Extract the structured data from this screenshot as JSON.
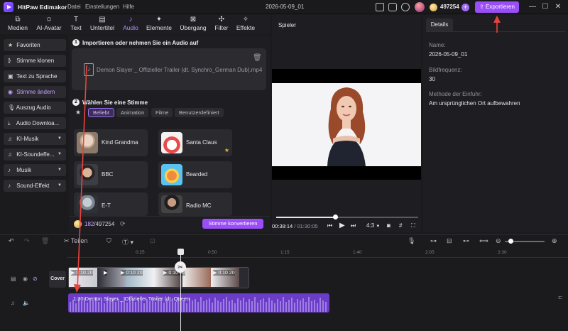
{
  "app": {
    "title": "HitPaw Edimakor",
    "menus": [
      "Datei",
      "Einstellungen",
      "Hilfe"
    ],
    "project_title": "2026-05-09_01",
    "credits": "497254",
    "plus": "+",
    "export_label": "Exportieren",
    "window_controls": [
      "—",
      "☐",
      "✕"
    ]
  },
  "toolbar": {
    "tabs": [
      {
        "label": "Medien",
        "icon": "media-icon"
      },
      {
        "label": "AI-Avatar",
        "icon": "ai-avatar-icon"
      },
      {
        "label": "Text",
        "icon": "text-icon"
      },
      {
        "label": "Untertitel",
        "icon": "subtitle-icon"
      },
      {
        "label": "Audio",
        "icon": "audio-icon"
      },
      {
        "label": "Elemente",
        "icon": "elements-icon"
      },
      {
        "label": "Übergang",
        "icon": "transition-icon"
      },
      {
        "label": "Filter",
        "icon": "filter-icon"
      },
      {
        "label": "Effekte",
        "icon": "effects-icon"
      }
    ],
    "active": "Audio"
  },
  "sidebar": {
    "items": [
      {
        "label": "Favoriten",
        "icon": "star-icon"
      },
      {
        "label": "Stimme klonen",
        "icon": "clone-icon"
      },
      {
        "label": "Text zu Sprache",
        "icon": "tts-icon"
      },
      {
        "label": "Stimme ändern",
        "icon": "voice-change-icon"
      },
      {
        "label": "Auszug Audio",
        "icon": "mic-icon"
      },
      {
        "label": "Audio Downloa...",
        "icon": "download-icon"
      },
      {
        "label": "KI-Musik",
        "icon": "ai-music-icon"
      },
      {
        "label": "KI-Soundeffe...",
        "icon": "ai-sfx-icon"
      },
      {
        "label": "Musik",
        "icon": "music-icon"
      },
      {
        "label": "Sound-Effekt",
        "icon": "sfx-icon"
      }
    ],
    "active": "Stimme ändern"
  },
  "voice_changer": {
    "step1_num": "1",
    "step1_title": "Importieren oder nehmen Sie ein Audio auf",
    "file_name": "Demon Slayer _ Offizieller Trailer (dt. Synchro_German Dub).mp4",
    "step2_num": "2",
    "step2_title": "Wählen Sie eine Stimme",
    "categories": [
      "Beliebt",
      "Animation",
      "Filme",
      "Benutzerdefiniert"
    ],
    "active_category": "Beliebt",
    "voices": [
      "Kind Grandma",
      "Santa Claus",
      "BBC",
      "Bearded",
      "E-T",
      "Radio MC"
    ],
    "credits_used": "182",
    "credits_total": "/497254",
    "convert_label": "Stimme konvertieren"
  },
  "player": {
    "label": "Spieler",
    "current_time": "00:38:14",
    "total_time": "/ 01:30:05",
    "aspect": "4:3",
    "progress_fraction": 0.42
  },
  "details": {
    "tab": "Details",
    "name_label": "Name:",
    "name_value": "2026-05-09_01",
    "fps_label": "Bildfrequenz:",
    "fps_value": "30",
    "method_label": "Methode der Einfuhr:",
    "method_value": "Am ursprünglichen Ort aufbewahren"
  },
  "timeline": {
    "split_label": "Teilen",
    "ticks": [
      "0:25",
      "0:50",
      "1:15",
      "1:40",
      "2:05",
      "2:30"
    ],
    "cover_label": "Cover",
    "video_clip_label": "0:10 20",
    "audio_clip_label": "1:30 Demon Slayer _ Offizieller Trailer (dt. Queen"
  },
  "colors": {
    "accent": "#9b4dfa",
    "annotation_arrow": "#e8433a",
    "audio_track": "#6a3cc7"
  }
}
